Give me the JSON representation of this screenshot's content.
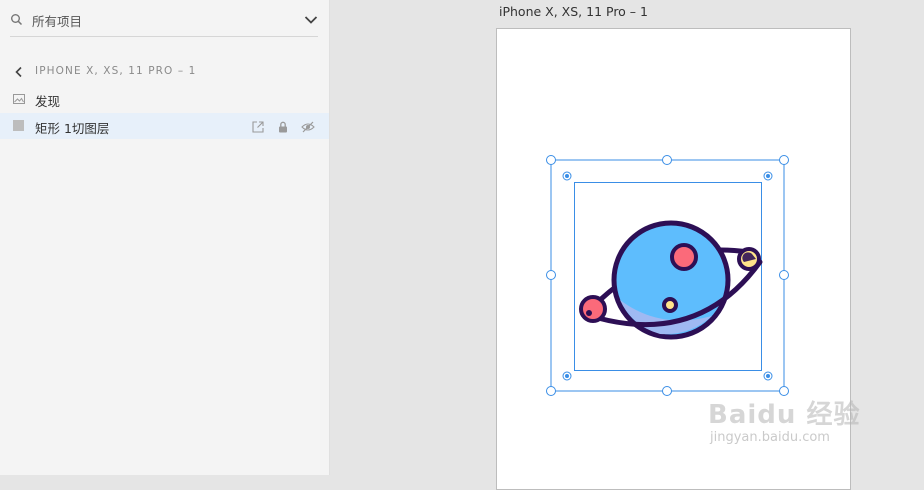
{
  "layers_panel": {
    "search": {
      "placeholder": "所有项目",
      "value": ""
    },
    "breadcrumb": "IPHONE X, XS, 11 PRO – 1",
    "layers": [
      {
        "label": "发现",
        "icon": "image-icon",
        "selected": false
      },
      {
        "label": "矩形 1切图层",
        "icon": "rectangle-icon",
        "selected": true
      }
    ]
  },
  "canvas": {
    "artboard_title": "iPhone X, XS, 11 Pro – 1",
    "selection_color": "#3a8ee6",
    "planet_colors": {
      "outline": "#2d0f55",
      "body": "#5ebdfd",
      "body_shade": "#9fb9f2",
      "spot": "#fb6a7a",
      "moon_dot": "#ffe38a"
    }
  },
  "watermark": {
    "brand": "Baidu 经验",
    "url": "jingyan.baidu.com"
  }
}
